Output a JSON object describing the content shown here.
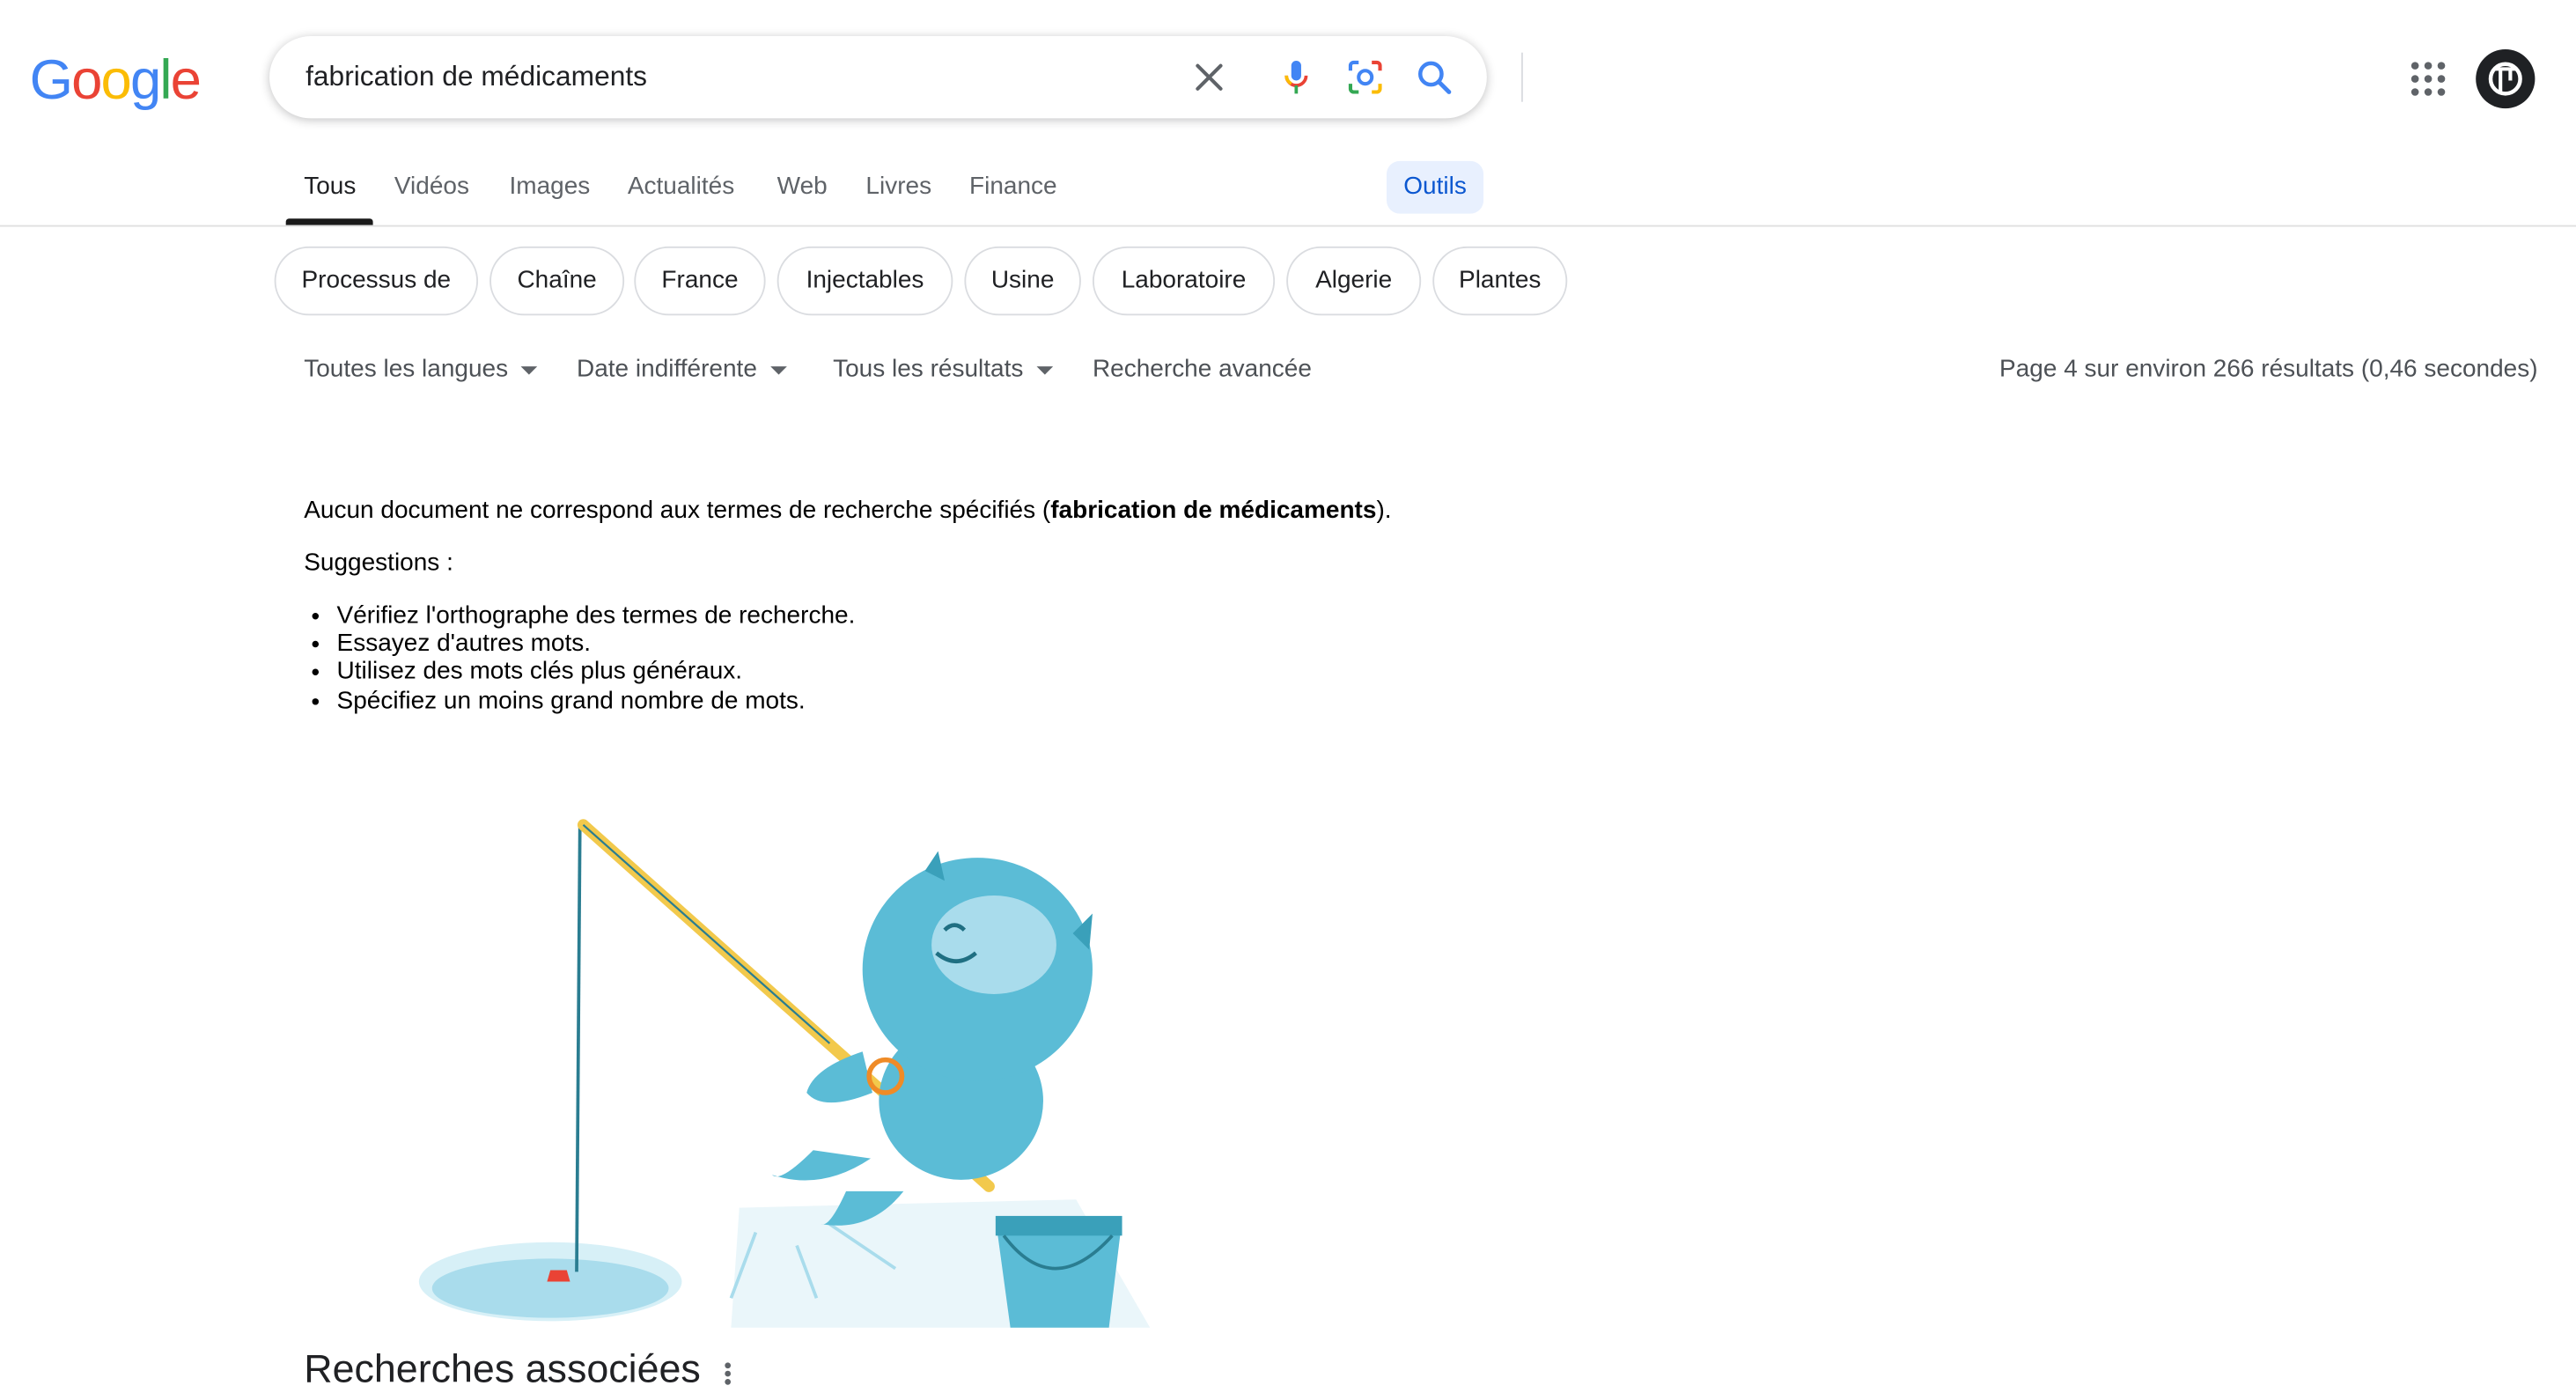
{
  "header": {
    "logo_letters": [
      {
        "char": "G",
        "color": "#4285F4"
      },
      {
        "char": "o",
        "color": "#EA4335"
      },
      {
        "char": "o",
        "color": "#FBBC05"
      },
      {
        "char": "g",
        "color": "#4285F4"
      },
      {
        "char": "l",
        "color": "#34A853"
      },
      {
        "char": "e",
        "color": "#EA4335"
      }
    ],
    "search": {
      "value": "fabrication de médicaments",
      "icons": [
        "clear-icon",
        "microphone-icon",
        "lens-icon",
        "search-icon"
      ]
    },
    "apps_icon": "apps-grid-icon",
    "avatar_icon": "account-avatar"
  },
  "tabs": [
    {
      "label": "Tous",
      "active": true
    },
    {
      "label": "Vidéos"
    },
    {
      "label": "Images"
    },
    {
      "label": "Actualités"
    },
    {
      "label": "Web"
    },
    {
      "label": "Livres"
    },
    {
      "label": "Finance"
    }
  ],
  "tools_label": "Outils",
  "chips": [
    "Processus de",
    "Chaîne",
    "France",
    "Injectables",
    "Usine",
    "Laboratoire",
    "Algerie",
    "Plantes"
  ],
  "filters": {
    "languages": "Toutes les langues",
    "date": "Date indifférente",
    "results": "Tous les résultats",
    "advanced": "Recherche avancée"
  },
  "stats": "Page 4 sur environ 266 résultats (0,46 secondes)",
  "no_results": {
    "prefix": "Aucun document ne correspond aux termes de recherche spécifiés (",
    "query": "fabrication de médicaments",
    "suffix": ").",
    "suggestions_title": "Suggestions :",
    "suggestions": [
      "Vérifiez l'orthographe des termes de recherche.",
      "Essayez d'autres mots.",
      "Utilisez des mots clés plus généraux.",
      "Spécifiez un moins grand nombre de mots."
    ]
  },
  "related_title": "Recherches associées",
  "colors": {
    "accent_blue": "#0b57d0",
    "tools_bg": "#e8f0fe",
    "creature": "#5bbcd6"
  }
}
